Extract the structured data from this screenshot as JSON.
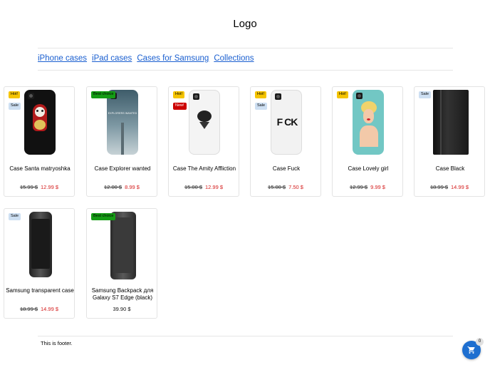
{
  "header": {
    "logo": "Logo"
  },
  "nav": [
    "iPhone cases",
    "iPad cases",
    "Cases for Samsung",
    "Collections"
  ],
  "products": [
    {
      "name": "Case Santa matryoshka",
      "old_price": "15.99 $",
      "price": "12.99 $",
      "badges": [
        "Hot!",
        "Sale"
      ]
    },
    {
      "name": "Case Explorer wanted",
      "old_price": "12.00 $",
      "price": "8.99 $",
      "badges": [
        "Best choice"
      ],
      "print_text": "EXPLORERS WANTED"
    },
    {
      "name": "Case The Amity Affliction",
      "old_price": "15.00 $",
      "price": "12.99 $",
      "badges": [
        "Hot!",
        "New!"
      ]
    },
    {
      "name": "Case Fuck",
      "old_price": "15.00 $",
      "price": "7.50 $",
      "badges": [
        "Hot!",
        "Sale"
      ],
      "print_text": "F CK"
    },
    {
      "name": "Case Lovely girl",
      "old_price": "12.99 $",
      "price": "9.99 $",
      "badges": [
        "Hot!"
      ]
    },
    {
      "name": "Case Black",
      "old_price": "18.99 $",
      "price": "14.99 $",
      "badges": [
        "Sale"
      ]
    },
    {
      "name": "Samsung transparent case",
      "old_price": "18.99 $",
      "price": "14.99 $",
      "badges": [
        "Sale"
      ]
    },
    {
      "name": "Samsung Backpack для Galaxy S7 Edge (black)",
      "price": "39.90 $",
      "badges": [
        "Best choice"
      ]
    }
  ],
  "footer": {
    "text": "This is footer."
  },
  "cart": {
    "count": "0",
    "icon": "shopping-cart-icon"
  },
  "colors": {
    "link": "#1a5fd0",
    "sale_price": "#d52020",
    "hot": "#f5c400",
    "sale": "#cddff2",
    "new": "#cc0000",
    "best": "#159c15",
    "cart": "#1e6fd0"
  }
}
